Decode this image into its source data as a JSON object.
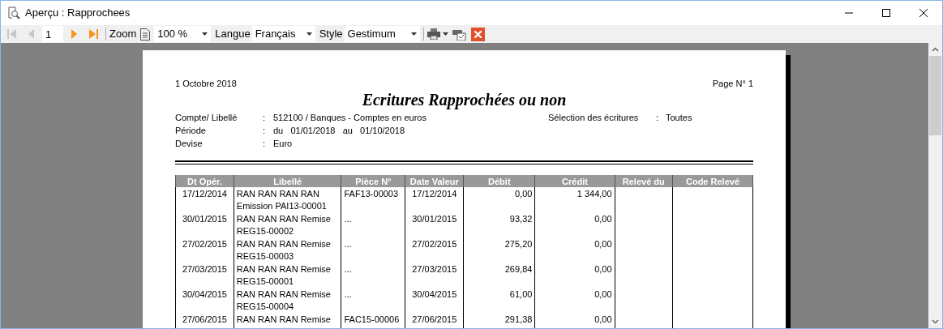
{
  "window": {
    "title": "Aperçu : Rapprochees"
  },
  "toolbar": {
    "nav": [
      {
        "kind": "first",
        "disabled": true
      },
      {
        "kind": "prev",
        "disabled": true
      },
      {
        "kind": "next",
        "disabled": false
      },
      {
        "kind": "last",
        "disabled": false
      }
    ],
    "page": "1",
    "zoom_label": "Zoom",
    "zoom": "100 %",
    "language_label": "Langue",
    "language": "Français",
    "style_label": "Style",
    "style": "Gestimum"
  },
  "report": {
    "date": "1 Octobre 2018",
    "page": "Page N° 1",
    "title": "Ecritures Rapprochées ou non",
    "fields_left": [
      {
        "label": "Compte/ Libellé",
        "separator": ":",
        "value": "512100 / Banques - Comptes en euros"
      },
      {
        "label": "Période",
        "separator": ":",
        "value": "du   01/01/2018   au   01/10/2018"
      },
      {
        "label": "Devise",
        "separator": ":",
        "value": "Euro"
      }
    ],
    "fields_right": [
      {
        "label": "Sélection des écritures",
        "separator": ":",
        "value": "Toutes"
      }
    ],
    "columns": [
      "Dt Opér.",
      "Libellé",
      "Pièce N°",
      "Date Valeur",
      "Débit",
      "Crédit",
      "Relevé du",
      "Code Relevé"
    ],
    "rows": [
      [
        "17/12/2014",
        "RAN RAN RAN RAN Emission PAI13-00001",
        "FAF13-00003",
        "17/12/2014",
        "0,00",
        "1 344,00",
        "",
        ""
      ],
      [
        "30/01/2015",
        "RAN RAN RAN Remise REG15-00002",
        "...",
        "30/01/2015",
        "93,32",
        "0,00",
        "",
        ""
      ],
      [
        "27/02/2015",
        "RAN RAN RAN Remise REG15-00003",
        "...",
        "27/02/2015",
        "275,20",
        "0,00",
        "",
        ""
      ],
      [
        "27/03/2015",
        "RAN RAN RAN Remise REG15-00001",
        "...",
        "27/03/2015",
        "269,84",
        "0,00",
        "",
        ""
      ],
      [
        "30/04/2015",
        "RAN RAN RAN Remise REG15-00004",
        "...",
        "30/04/2015",
        "61,00",
        "0,00",
        "",
        ""
      ],
      [
        "27/06/2015",
        "RAN RAN RAN Remise",
        "FAC15-00006",
        "27/06/2015",
        "291,38",
        "0,00",
        "",
        ""
      ]
    ]
  }
}
